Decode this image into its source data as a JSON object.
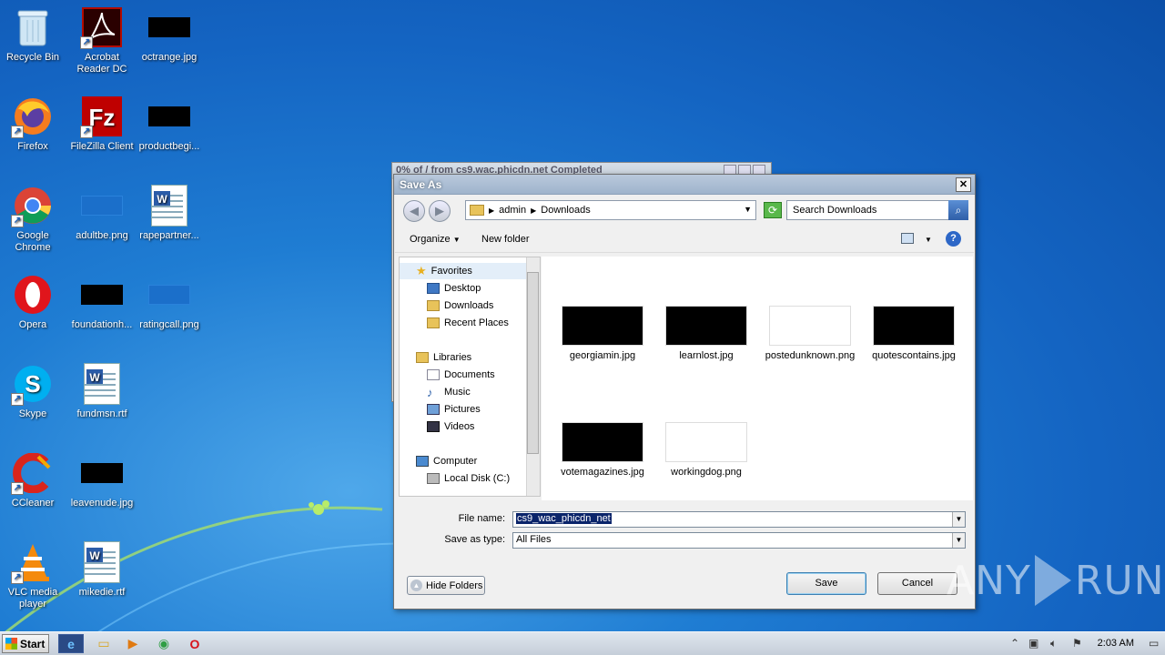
{
  "desktop": {
    "icons": [
      {
        "label": "Recycle Bin",
        "icon": "recycle-bin-icon"
      },
      {
        "label": "Acrobat Reader DC",
        "icon": "acrobat-icon"
      },
      {
        "label": "octrange.jpg",
        "icon": "image-file-icon"
      },
      {
        "label": "Firefox",
        "icon": "firefox-icon"
      },
      {
        "label": "FileZilla Client",
        "icon": "filezilla-icon"
      },
      {
        "label": "productbegi...",
        "icon": "image-file-icon"
      },
      {
        "label": "Google Chrome",
        "icon": "chrome-icon"
      },
      {
        "label": "adultbe.png",
        "icon": "image-file-icon"
      },
      {
        "label": "rapepartner...",
        "icon": "word-doc-icon"
      },
      {
        "label": "Opera",
        "icon": "opera-icon"
      },
      {
        "label": "foundationh...",
        "icon": "image-file-icon"
      },
      {
        "label": "ratingcall.png",
        "icon": "image-file-icon"
      },
      {
        "label": "Skype",
        "icon": "skype-icon"
      },
      {
        "label": "fundmsn.rtf",
        "icon": "word-doc-icon"
      },
      {
        "label": "CCleaner",
        "icon": "ccleaner-icon"
      },
      {
        "label": "leavenude.jpg",
        "icon": "image-file-icon"
      },
      {
        "label": "VLC media player",
        "icon": "vlc-icon"
      },
      {
        "label": "mikedie.rtf",
        "icon": "word-doc-icon"
      }
    ]
  },
  "background_window": {
    "title": "0% of / from cs9.wac.phicdn.net Completed"
  },
  "dialog": {
    "title": "Save As",
    "close_label": "✕",
    "breadcrumb": [
      "admin",
      "Downloads"
    ],
    "search_placeholder": "Search Downloads",
    "organize_label": "Organize",
    "new_folder_label": "New folder",
    "help_label": "?",
    "tree": {
      "favorites": "Favorites",
      "desktop": "Desktop",
      "downloads": "Downloads",
      "recent": "Recent Places",
      "libraries": "Libraries",
      "documents": "Documents",
      "music": "Music",
      "pictures": "Pictures",
      "videos": "Videos",
      "computer": "Computer",
      "local_disk": "Local Disk (C:)"
    },
    "files": [
      {
        "name": "georgiamin.jpg",
        "bg": "#000000"
      },
      {
        "name": "learnlost.jpg",
        "bg": "#000000"
      },
      {
        "name": "postedunknown.png",
        "bg": "#ffffff"
      },
      {
        "name": "quotescontains.jpg",
        "bg": "#000000"
      },
      {
        "name": "votemagazines.jpg",
        "bg": "#000000"
      },
      {
        "name": "workingdog.png",
        "bg": "#ffffff"
      }
    ],
    "file_name_label": "File name:",
    "file_name_value": "cs9_wac_phicdn_net",
    "save_type_label": "Save as type:",
    "save_type_value": "All Files",
    "hide_folders_label": "Hide Folders",
    "save_label": "Save",
    "cancel_label": "Cancel"
  },
  "taskbar": {
    "start_label": "Start",
    "clock": "2:03 AM"
  },
  "watermark": {
    "text_left": "ANY",
    "text_right": "RUN"
  }
}
